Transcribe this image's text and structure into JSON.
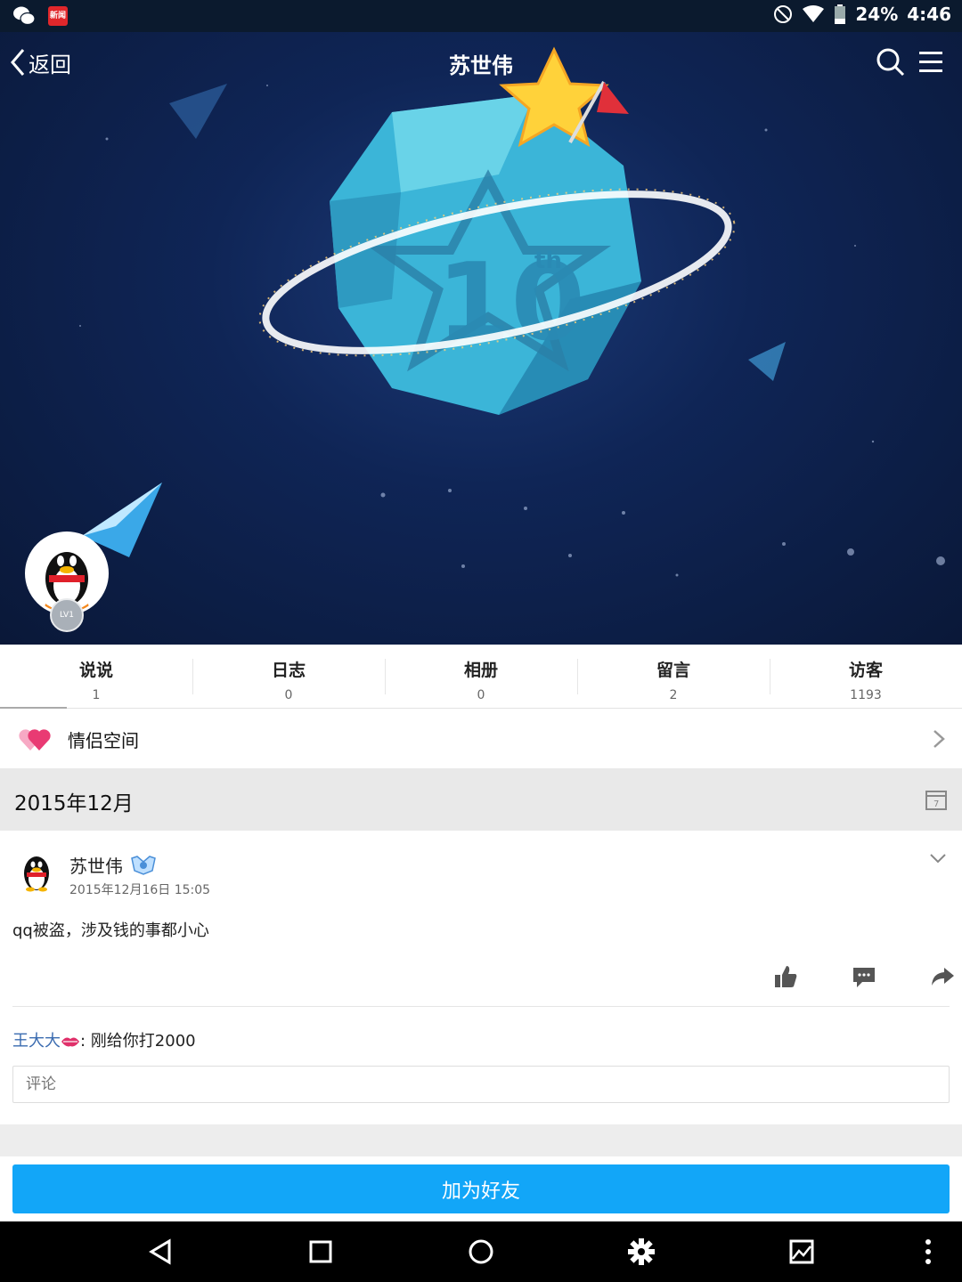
{
  "status_bar": {
    "battery": "24%",
    "time": "4:46",
    "icons": [
      "wechat-icon",
      "news-icon",
      "do-not-disturb-icon",
      "wifi-icon",
      "battery-icon"
    ]
  },
  "nav": {
    "back_label": "返回",
    "title": "苏世伟"
  },
  "profile": {
    "level_badge": "LV1"
  },
  "stats": [
    {
      "label": "说说",
      "count": "1"
    },
    {
      "label": "日志",
      "count": "0"
    },
    {
      "label": "相册",
      "count": "0"
    },
    {
      "label": "留言",
      "count": "2"
    },
    {
      "label": "访客",
      "count": "1193"
    }
  ],
  "couple_space": {
    "label": "情侣空间"
  },
  "timeline": {
    "month": "2015年12月"
  },
  "post": {
    "author": "苏世伟",
    "time": "2015年12月16日 15:05",
    "text": "qq被盗，涉及钱的事都小心",
    "comments": [
      {
        "user": "王大大",
        "text": ": 刚给你打2000"
      }
    ],
    "comment_placeholder": "评论"
  },
  "cta": {
    "add_friend": "加为好友"
  },
  "colors": {
    "accent": "#12a6f8",
    "link": "#3a6bb0",
    "banner_bg": "#0f2556"
  }
}
